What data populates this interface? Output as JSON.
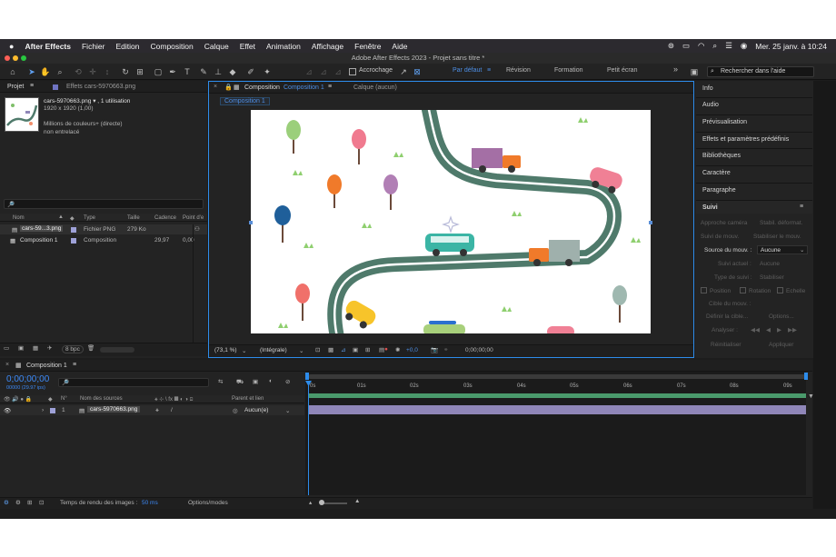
{
  "menubar": {
    "apple": "",
    "items": [
      "After Effects",
      "Fichier",
      "Edition",
      "Composition",
      "Calque",
      "Effet",
      "Animation",
      "Affichage",
      "Fenêtre",
      "Aide"
    ],
    "datetime": "Mer. 25 janv. à 10:24"
  },
  "window": {
    "title": "Adobe After Effects 2023 - Projet sans titre *"
  },
  "toolbar": {
    "snapping_label": "Accrochage",
    "workspaces": [
      "Par défaut",
      "Révision",
      "Formation",
      "Petit écran"
    ],
    "active_workspace": "Par défaut",
    "more": "»",
    "help_placeholder": "Rechercher dans l'aide"
  },
  "project_panel": {
    "tab_label": "Projet",
    "effects_tab": "Effets cars-5970663.png",
    "file_name": "cars-5970663.png ▾ , 1 utilisation",
    "dimensions": "1920 x 1920 (1,00)",
    "colors": "Millions de couleurs+ (directe)",
    "interlace": "non entrelacé",
    "search_icon": "🔎",
    "columns": [
      "Nom",
      "Type",
      "Taille",
      "Cadence",
      "Point d'e"
    ],
    "rows": [
      {
        "name": "cars-59...3.png",
        "type": "Fichier PNG",
        "size": "279 Ko",
        "rate": "",
        "point": ""
      },
      {
        "name": "Composition 1",
        "type": "Composition",
        "size": "",
        "rate": "29,97",
        "point": "0,00"
      }
    ],
    "bpc": "8 bpc"
  },
  "comp_panel": {
    "tab_label": "Composition",
    "tab_link": "Composition 1",
    "layer_tab": "Calque (aucun)",
    "sub_tab": "Composition 1",
    "zoom": "(73,1 %)",
    "resolution": "(Intégrale)",
    "exposure": "+0,0",
    "timecode": "0;00;00;00"
  },
  "right_panel": {
    "items": [
      "Info",
      "Audio",
      "Prévisualisation",
      "Effets et paramètres prédéfinis",
      "Bibliothèques",
      "Caractère",
      "Paragraphe"
    ],
    "tracker": {
      "title": "Suivi",
      "track_camera": "Approche caméra",
      "warp_stabilizer": "Stabil. déformat.",
      "track_motion": "Suivi de mouv.",
      "stabilize_motion": "Stabiliser le mouv.",
      "motion_source_label": "Source du mouv. :",
      "motion_source_value": "Aucune",
      "current_track_label": "Suivi actuel :",
      "current_track_value": "Aucune",
      "track_type_label": "Type de suivi :",
      "track_type_value": "Stabiliser",
      "position": "Position",
      "rotation": "Rotation",
      "scale": "Echelle",
      "motion_target": "Cible du mouv. :",
      "edit_target": "Définir la cible...",
      "options": "Options...",
      "analyze": "Analyser :",
      "reset": "Réinitialiser",
      "apply": "Appliquer"
    }
  },
  "timeline": {
    "tab_label": "Composition 1",
    "timecode": "0;00;00;00",
    "frame_info": "00000 (29.97 ips)",
    "search_icon": "🔎",
    "columns": {
      "number": "N°",
      "source_name": "Nom des sources",
      "parent": "Parent et lien"
    },
    "ruler": [
      "0s",
      "01s",
      "02s",
      "03s",
      "04s",
      "05s",
      "06s",
      "07s",
      "08s",
      "09s"
    ],
    "layers": [
      {
        "number": "1",
        "name": "cars-5970663.png",
        "parent": "Aucun(e)"
      }
    ],
    "render_label": "Temps de rendu des images :",
    "render_value": "50 ms",
    "options_modes": "Options/modes"
  },
  "colors": {
    "accent_blue": "#2d8ceb",
    "road": "#4f7a6b",
    "track_bar": "#4a9a6c",
    "layer_bar": "#8f86b8"
  }
}
